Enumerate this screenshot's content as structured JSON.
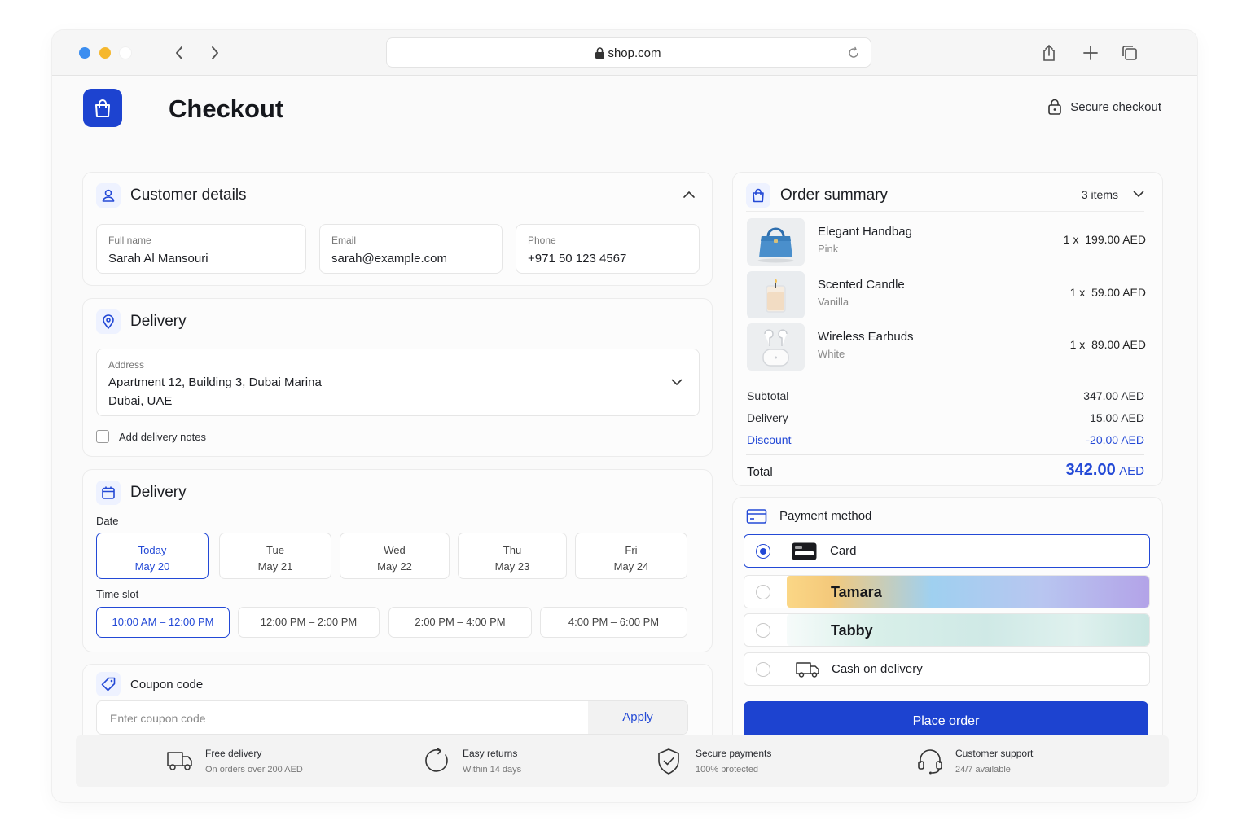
{
  "browser": {
    "url": "shop.com",
    "traffic_colors": [
      "#3b8df0",
      "#f5b72d",
      "#ffffff"
    ]
  },
  "page": {
    "title": "Checkout",
    "secure_label": "Secure checkout"
  },
  "customer": {
    "heading": "Customer details",
    "full_name_label": "Full name",
    "full_name": "Sarah Al Mansouri",
    "email_label": "Email",
    "email": "sarah@example.com",
    "phone_label": "Phone",
    "phone": "+971 50 123 4567"
  },
  "delivery_address": {
    "heading": "Delivery",
    "address_label": "Address",
    "address_line1": "Apartment 12, Building 3, Dubai Marina",
    "address_line2": "Dubai, UAE",
    "notes_label": "Add delivery notes",
    "notes_checked": false
  },
  "delivery_time": {
    "heading": "Delivery",
    "date_label": "Date",
    "dates": [
      {
        "day": "Today",
        "date": "May 20",
        "selected": true
      },
      {
        "day": "Tue",
        "date": "May 21",
        "selected": false
      },
      {
        "day": "Wed",
        "date": "May 22",
        "selected": false
      },
      {
        "day": "Thu",
        "date": "May 23",
        "selected": false
      },
      {
        "day": "Fri",
        "date": "May 24",
        "selected": false
      }
    ],
    "slot_label": "Time slot",
    "slots": [
      {
        "label": "10:00 AM – 12:00 PM",
        "selected": true
      },
      {
        "label": "12:00 PM – 2:00 PM",
        "selected": false
      },
      {
        "label": "2:00 PM – 4:00 PM",
        "selected": false
      },
      {
        "label": "4:00 PM – 6:00 PM",
        "selected": false
      }
    ]
  },
  "coupon": {
    "heading": "Coupon code",
    "placeholder": "Enter coupon code",
    "apply_label": "Apply"
  },
  "order": {
    "heading": "Order summary",
    "items_count": "3 items",
    "items": [
      {
        "name": "Elegant Handbag",
        "variant": "Pink",
        "qty": "1 x",
        "price": "199.00 AED",
        "icon": "handbag-thumbnail"
      },
      {
        "name": "Scented Candle",
        "variant": "Vanilla",
        "qty": "1 x",
        "price": "59.00 AED",
        "icon": "candle-thumbnail"
      },
      {
        "name": "Wireless Earbuds",
        "variant": "White",
        "qty": "1 x",
        "price": "89.00 AED",
        "icon": "earbuds-thumbnail"
      }
    ],
    "subtotal_label": "Subtotal",
    "subtotal": "347.00 AED",
    "delivery_label": "Delivery",
    "delivery": "15.00 AED",
    "discount_label": "Discount",
    "discount": "-20.00 AED",
    "total_label": "Total",
    "total_amount": "342.00",
    "total_currency": "AED"
  },
  "payment": {
    "heading": "Payment method",
    "options": [
      {
        "label": "Card",
        "selected": true
      },
      {
        "label": "Tamara",
        "selected": false
      },
      {
        "label": "Tabby",
        "selected": false
      },
      {
        "label": "Cash on delivery",
        "selected": false
      }
    ],
    "place_order_label": "Place order",
    "accent": "#1d43d0"
  },
  "features": [
    {
      "title": "Free delivery",
      "subtitle": "On orders over 200 AED",
      "icon": "truck-icon"
    },
    {
      "title": "Easy returns",
      "subtitle": "Within 14 days",
      "icon": "returns-icon"
    },
    {
      "title": "Secure payments",
      "subtitle": "100% protected",
      "icon": "shield-icon"
    },
    {
      "title": "Customer support",
      "subtitle": "24/7 available",
      "icon": "headset-icon"
    }
  ]
}
